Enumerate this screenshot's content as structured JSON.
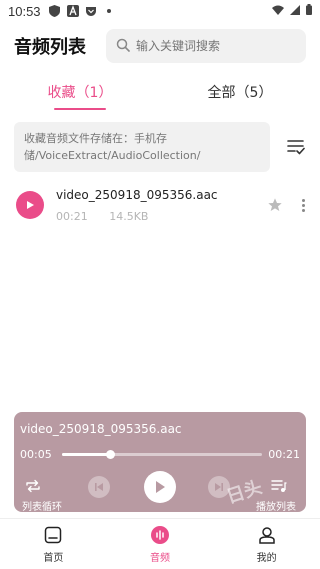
{
  "status_bar": {
    "time": "10:53",
    "icons": [
      "shield-icon",
      "a-badge-icon",
      "pocket-icon",
      "dot-icon",
      "wifi-icon",
      "signal-icon",
      "battery-icon"
    ]
  },
  "header": {
    "title": "音频列表",
    "search_placeholder": "输入关键词搜索"
  },
  "tabs": [
    {
      "label": "收藏（1）",
      "active": true
    },
    {
      "label": "全部（5）",
      "active": false
    }
  ],
  "storage_path": "收藏音频文件存储在：手机存储/VoiceExtract/AudioCollection/",
  "files": [
    {
      "name": "video_250918_095356.aac",
      "duration": "00:21",
      "size": "14.5KB"
    }
  ],
  "player": {
    "title": "video_250918_095356.aac",
    "current_time": "00:05",
    "total_time": "00:21",
    "progress_fraction": 0.24,
    "loop_label": "列表循环",
    "playlist_label": "播放列表"
  },
  "watermark": "日头",
  "bottom_nav": [
    {
      "label": "首页",
      "icon": "home-icon",
      "active": false
    },
    {
      "label": "音频",
      "icon": "audio-wave-icon",
      "active": true
    },
    {
      "label": "我的",
      "icon": "person-icon",
      "active": false
    }
  ],
  "colors": {
    "accent": "#ea4c89",
    "player_bg": "#b89aa2",
    "field_bg": "#f1f1f1"
  }
}
